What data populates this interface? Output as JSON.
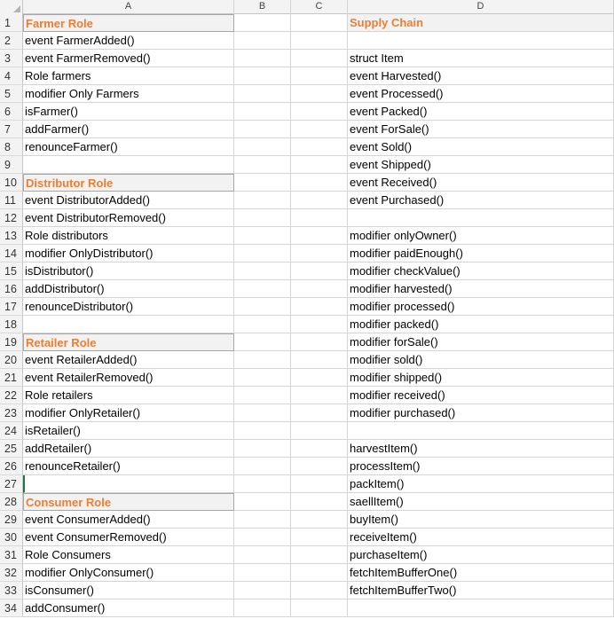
{
  "columns": [
    "A",
    "B",
    "C",
    "D"
  ],
  "rows": [
    {
      "n": "1",
      "a": "Farmer Role",
      "d": "Supply Chain",
      "a_header": true,
      "d_header": true
    },
    {
      "n": "2",
      "a": "event FarmerAdded()",
      "d": ""
    },
    {
      "n": "3",
      "a": "event FarmerRemoved()",
      "d": "struct Item"
    },
    {
      "n": "4",
      "a": "Role farmers",
      "d": "event Harvested()"
    },
    {
      "n": "5",
      "a": "modifier Only Farmers",
      "d": "event Processed()"
    },
    {
      "n": "6",
      "a": "isFarmer()",
      "d": "event Packed()"
    },
    {
      "n": "7",
      "a": "addFarmer()",
      "d": "event ForSale()"
    },
    {
      "n": "8",
      "a": "renounceFarmer()",
      "d": "event Sold()"
    },
    {
      "n": "9",
      "a": "",
      "d": "event Shipped()"
    },
    {
      "n": "10",
      "a": "Distributor Role",
      "d": "event Received()",
      "a_header": true
    },
    {
      "n": "11",
      "a": "event DistributorAdded()",
      "d": "event Purchased()"
    },
    {
      "n": "12",
      "a": "event DistributorRemoved()",
      "d": ""
    },
    {
      "n": "13",
      "a": "Role distributors",
      "d": "modifier onlyOwner()"
    },
    {
      "n": "14",
      "a": "modifier OnlyDistributor()",
      "d": "modifier paidEnough()"
    },
    {
      "n": "15",
      "a": "isDistributor()",
      "d": " modifier checkValue()"
    },
    {
      "n": "16",
      "a": "addDistributor()",
      "d": "modifier harvested()"
    },
    {
      "n": "17",
      "a": "renounceDistributor()",
      "d": "modifier processed()"
    },
    {
      "n": "18",
      "a": "",
      "d": "modifier packed()"
    },
    {
      "n": "19",
      "a": "Retailer Role",
      "d": "modifier forSale()",
      "a_header": true
    },
    {
      "n": "20",
      "a": "event RetailerAdded()",
      "d": "modifier sold()"
    },
    {
      "n": "21",
      "a": "event RetailerRemoved()",
      "d": "modifier shipped()"
    },
    {
      "n": "22",
      "a": "Role retailers",
      "d": "modifier received()"
    },
    {
      "n": "23",
      "a": "modifier OnlyRetailer()",
      "d": "modifier purchased()"
    },
    {
      "n": "24",
      "a": "isRetailer()",
      "d": ""
    },
    {
      "n": "25",
      "a": "addRetailer()",
      "d": "harvestItem()"
    },
    {
      "n": "26",
      "a": "renounceRetailer()",
      "d": "processItem()"
    },
    {
      "n": "27",
      "a": "",
      "d": "packItem()",
      "selected": true
    },
    {
      "n": "28",
      "a": "Consumer Role",
      "d": "saellItem()",
      "a_header": true
    },
    {
      "n": "29",
      "a": "event ConsumerAdded()",
      "d": "buyItem()"
    },
    {
      "n": "30",
      "a": "event ConsumerRemoved()",
      "d": "receiveItem()"
    },
    {
      "n": "31",
      "a": "Role Consumers",
      "d": "purchaseItem()"
    },
    {
      "n": "32",
      "a": "modifier OnlyConsumer()",
      "d": "fetchItemBufferOne()"
    },
    {
      "n": "33",
      "a": "isConsumer()",
      "d": "fetchItemBufferTwo()"
    },
    {
      "n": "34",
      "a": "addConsumer()",
      "d": ""
    }
  ],
  "colors": {
    "header_text": "#ed7d31",
    "header_fill": "#f2f2f2",
    "selection": "#217346"
  }
}
